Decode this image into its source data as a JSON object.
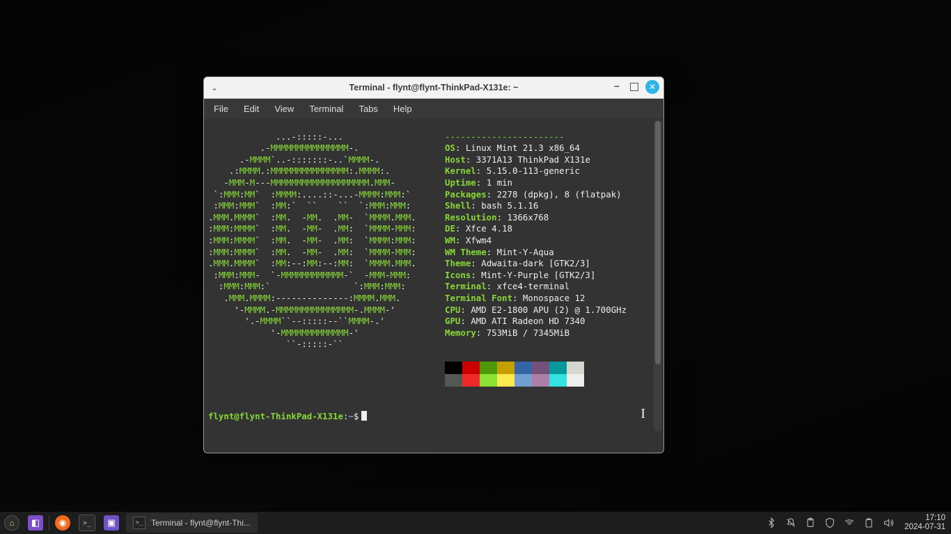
{
  "window": {
    "title": "Terminal - flynt@flynt-ThinkPad-X131e: ~",
    "menu": [
      "File",
      "Edit",
      "View",
      "Terminal",
      "Tabs",
      "Help"
    ]
  },
  "ascii": [
    "             ...-:::::-...",
    "          .-MMMMMMMMMMMMMMM-.",
    "      .-MMMM`..-:::::::-..`MMMM-.",
    "    .:MMMM.:MMMMMMMMMMMMMMM:.MMMM:.",
    "   -MMM-M---MMMMMMMMMMMMMMMMMMM.MMM-",
    " `:MMM:MM`  :MMMM:....::-...-MMMM:MMM:`",
    " :MMM:MMM`  :MM:`  ``    ``  `:MMM:MMM:",
    ".MMM.MMMM`  :MM.  -MM.  .MM-  `MMMM.MMM.",
    ":MMM:MMMM`  :MM.  -MM-  .MM:  `MMMM-MMM:",
    ":MMM:MMMM`  :MM.  -MM-  .MM:  `MMMM:MMM:",
    ":MMM:MMMM`  :MM.  -MM-  .MM:  `MMMM-MMM:",
    ".MMM.MMMM`  :MM:--:MM:--:MM:  `MMMM.MMM.",
    " :MMM:MMM-  `-MMMMMMMMMMMM-`  -MMM-MMM:",
    "  :MMM:MMM:`                `:MMM:MMM:",
    "   .MMM.MMMM:--------------:MMMM.MMM.",
    "     '-MMMM.-MMMMMMMMMMMMMMM-.MMMM-'",
    "       '.-MMMM``--:::::--``MMMM-.'",
    "            '-MMMMMMMMMMMMM-'",
    "               ``-:::::-``"
  ],
  "info_dash1": "-----------------------",
  "specs": [
    {
      "key": "OS",
      "val": "Linux Mint 21.3 x86_64"
    },
    {
      "key": "Host",
      "val": "3371A13 ThinkPad X131e"
    },
    {
      "key": "Kernel",
      "val": "5.15.0-113-generic"
    },
    {
      "key": "Uptime",
      "val": "1 min"
    },
    {
      "key": "Packages",
      "val": "2278 (dpkg), 8 (flatpak)"
    },
    {
      "key": "Shell",
      "val": "bash 5.1.16"
    },
    {
      "key": "Resolution",
      "val": "1366x768"
    },
    {
      "key": "DE",
      "val": "Xfce 4.18"
    },
    {
      "key": "WM",
      "val": "Xfwm4"
    },
    {
      "key": "WM Theme",
      "val": "Mint-Y-Aqua"
    },
    {
      "key": "Theme",
      "val": "Adwaita-dark [GTK2/3]"
    },
    {
      "key": "Icons",
      "val": "Mint-Y-Purple [GTK2/3]"
    },
    {
      "key": "Terminal",
      "val": "xfce4-terminal"
    },
    {
      "key": "Terminal Font",
      "val": "Monospace 12"
    },
    {
      "key": "CPU",
      "val": "AMD E2-1800 APU (2) @ 1.700GHz"
    },
    {
      "key": "GPU",
      "val": "AMD ATI Radeon HD 7340"
    },
    {
      "key": "Memory",
      "val": "753MiB / 7345MiB"
    }
  ],
  "swatches_row1": [
    "#000000",
    "#cc0000",
    "#4e9a06",
    "#c4a000",
    "#3465a4",
    "#75507b",
    "#06989a",
    "#d3d7cf"
  ],
  "swatches_row2": [
    "#555753",
    "#ef2929",
    "#8ae234",
    "#fce94f",
    "#729fcf",
    "#ad7fa8",
    "#34e2e2",
    "#eeeeec"
  ],
  "prompt": {
    "user": "flynt@flynt-ThinkPad-X131e",
    "path": "~",
    "sym": "$"
  },
  "taskbar": {
    "task_label": "Terminal - flynt@flynt-Thi...",
    "time": "17:10",
    "date": "2024-07-31"
  }
}
